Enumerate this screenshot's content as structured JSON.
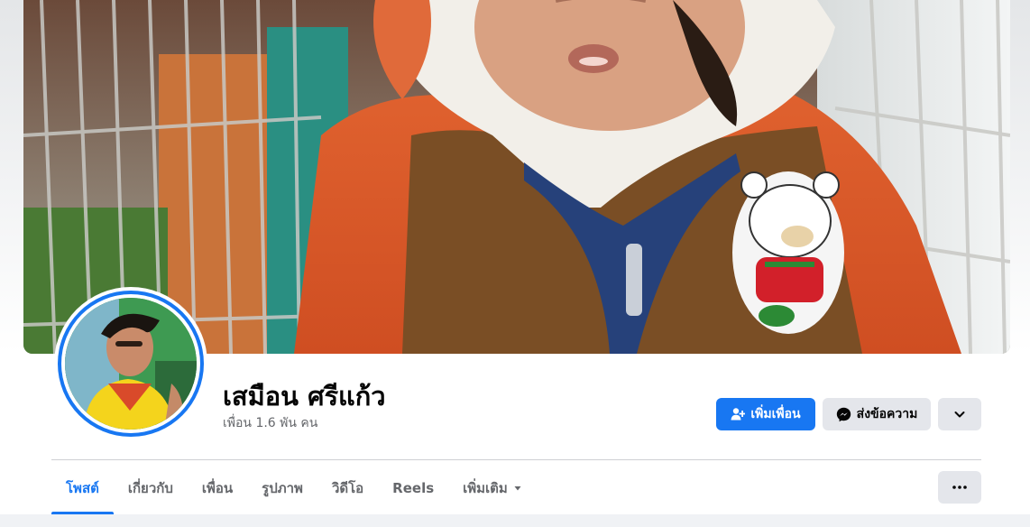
{
  "profile": {
    "name": "เสมือน ศรีแก้ว",
    "friends_count": "เพื่อน 1.6 พัน คน"
  },
  "actions": {
    "add_friend_label": "เพิ่มเพื่อน",
    "message_label": "ส่งข้อความ"
  },
  "tabs": [
    {
      "label": "โพสต์",
      "active": true
    },
    {
      "label": "เกี่ยวกับ"
    },
    {
      "label": "เพื่อน"
    },
    {
      "label": "รูปภาพ"
    },
    {
      "label": "วิดีโอ"
    },
    {
      "label": "Reels"
    },
    {
      "label": "เพิ่มเติม"
    }
  ],
  "icons": {
    "add_friend": "add-friend-icon",
    "message": "messenger-icon",
    "more": "chevron-down-icon",
    "tab_more": "caret-down-icon",
    "overflow": "more-dots-icon"
  },
  "colors": {
    "accent": "#1877f2",
    "secondary_button": "#e4e6eb",
    "text_primary": "#050505",
    "text_secondary": "#65676b"
  }
}
